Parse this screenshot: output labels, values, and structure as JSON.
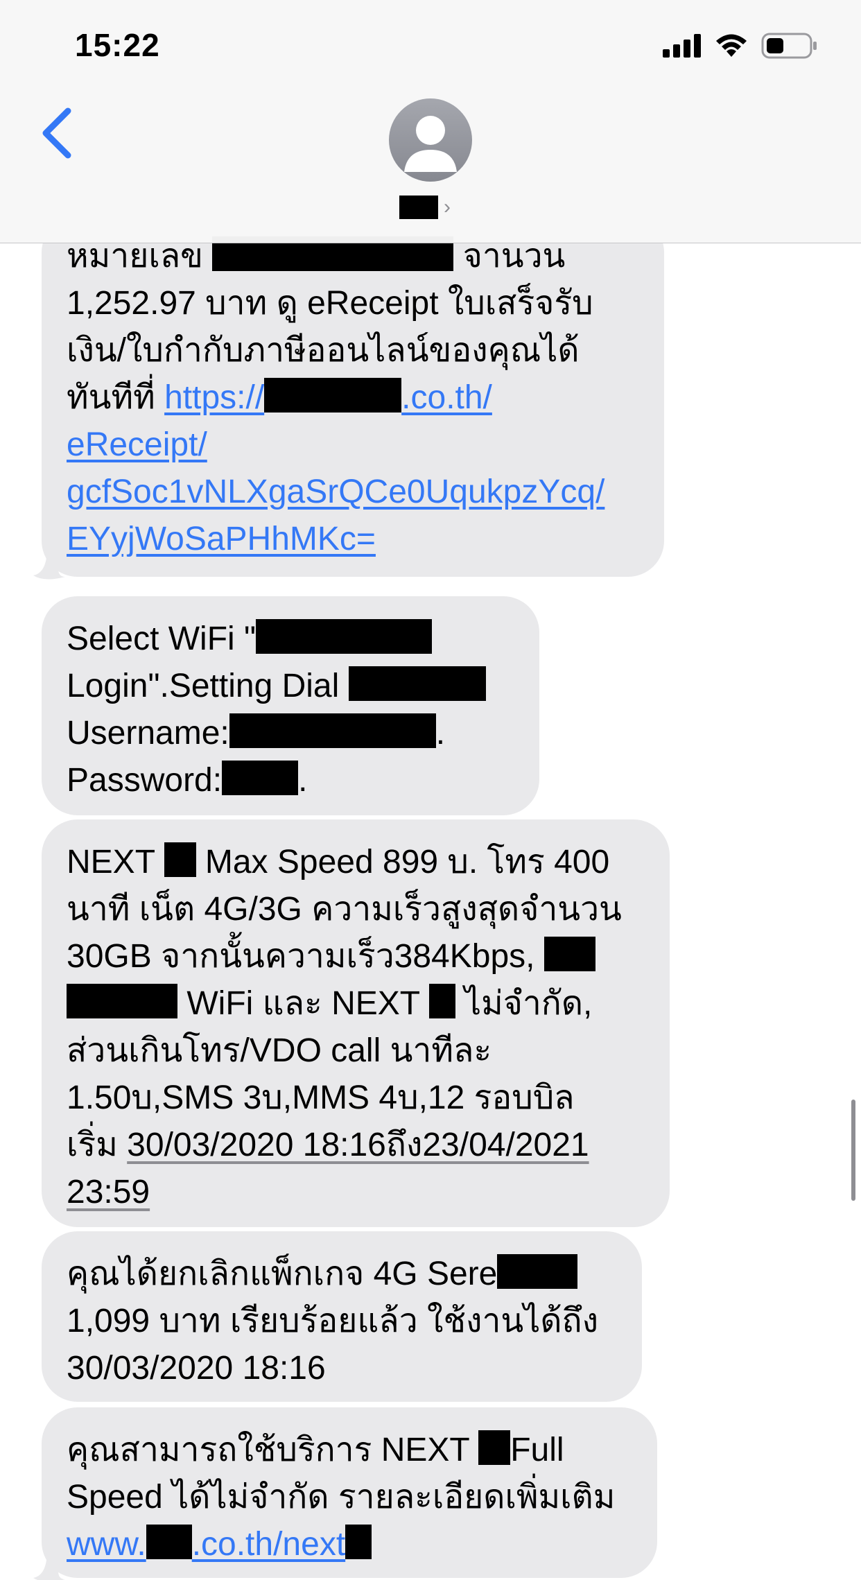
{
  "status_bar": {
    "time": "15:22"
  },
  "header": {
    "back_label": "‹",
    "chevron": "›"
  },
  "messages": [
    {
      "lines": [
        [
          "หมายเลข ",
          "█",
          " จานวน"
        ],
        [
          "1,252.97 บาท ดู eReceipt ใบเสร็จรับ"
        ],
        [
          "เงิน/ใบกำกับภาษีออนไลน์ของคุณได้"
        ],
        [
          "ทันทีที่ "
        ]
      ],
      "link_line1_a": "https://",
      "link_line1_b": ".co.th/",
      "link_line2": "eReceipt/",
      "link_line3": "gcfSoc1vNLXgaSrQCe0UqukpzYcq/",
      "link_line4": "EYyjWoSaPHhMKc=",
      "text_line1_a": "หมายเลข",
      "text_line1_b": "จานวน",
      "text_line2": "1,252.97 บาท ดู eReceipt ใบเสร็จรับ",
      "text_line3": "เงิน/ใบกำกับภาษีออนไลน์ของคุณได้",
      "text_line4": "ทันทีที่"
    },
    {
      "line1": "Select WiFi \"",
      "line2": "Login\".Setting Dial",
      "line3": "Username:",
      "line3_end": ".",
      "line4": "Password:",
      "line4_end": "."
    },
    {
      "line1_a": "NEXT",
      "line1_b": "Max Speed 899 บ. โทร 400",
      "line2": "นาที เน็ต 4G/3G ความเร็วสูงสุดจำนวน",
      "line3": "30GB จากนั้นความเร็ว384Kbps,",
      "line4_a": "WiFi และ NEXT",
      "line4_b": "ไม่จำกัด,",
      "line5": "ส่วนเกินโทร/VDO call นาทีละ",
      "line6": "1.50บ,SMS 3บ,MMS 4บ,12 รอบบิล",
      "line7_a": "เริ่ม",
      "line7_b": "30/03/2020 18:16ถึง23/04/2021",
      "line8": "23:59"
    },
    {
      "line1": "คุณได้ยกเลิกแพ็กเกจ 4G Sere",
      "line2": "1,099 บาท เรียบร้อยแล้ว ใช้งานได้ถึง",
      "line3": "30/03/2020 18:16"
    },
    {
      "line1_a": "คุณสามารถใช้บริการ NEXT",
      "line1_b": "Full",
      "line2": "Speed ได้ไม่จำกัด รายละเอียดเพิ่มเติม",
      "link_a": "www.",
      "link_b": ".co.th/next"
    }
  ],
  "icons": [
    "back-chevron-icon",
    "person-icon",
    "cellular-signal-icon",
    "wifi-icon",
    "battery-icon"
  ],
  "colors": {
    "bubble": "#e9e9eb",
    "link": "#3478f6",
    "accent": "#3478f6"
  }
}
